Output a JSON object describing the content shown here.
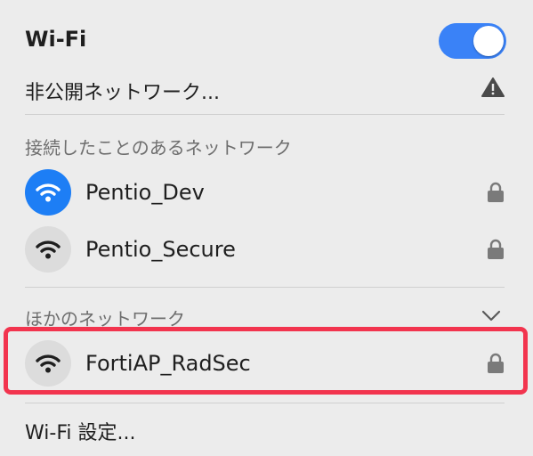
{
  "header": {
    "title": "Wi-Fi",
    "toggle_on": true
  },
  "hidden_network": {
    "label": "非公開ネットワーク..."
  },
  "known_section": {
    "label": "接続したことのあるネットワーク",
    "networks": [
      {
        "name": "Pentio_Dev",
        "active": true,
        "icon": "wifi-icon",
        "secured": true
      },
      {
        "name": "Pentio_Secure",
        "active": false,
        "icon": "wifi-icon",
        "secured": true
      }
    ]
  },
  "other_section": {
    "label": "ほかのネットワーク",
    "networks": [
      {
        "name": "FortiAP_RadSec",
        "active": false,
        "icon": "wifi-icon",
        "secured": true
      }
    ]
  },
  "footer": {
    "settings_label": "Wi-Fi 設定..."
  },
  "colors": {
    "accent": "#1d7ef5",
    "highlight": "#f2344e",
    "toggle": "#3a82f7"
  }
}
